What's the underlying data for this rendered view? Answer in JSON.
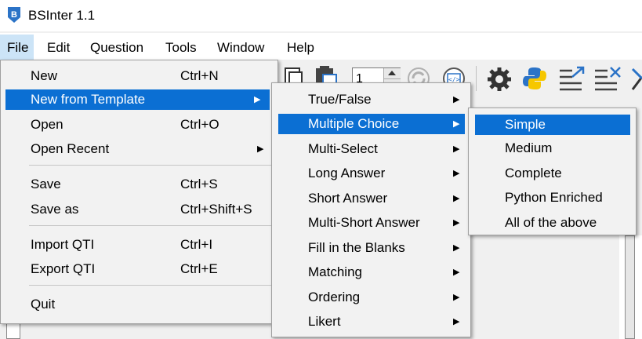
{
  "window": {
    "title": "BSInter 1.1"
  },
  "menubar": {
    "items": [
      "File",
      "Edit",
      "Question",
      "Tools",
      "Window",
      "Help"
    ]
  },
  "toolbar": {
    "spin_value": "1"
  },
  "file_menu": {
    "items": [
      {
        "label": "New",
        "shortcut": "Ctrl+N"
      },
      {
        "label": "New from Template",
        "shortcut": ""
      },
      {
        "label": "Open",
        "shortcut": "Ctrl+O"
      },
      {
        "label": "Open Recent",
        "shortcut": ""
      },
      {
        "label": "Save",
        "shortcut": "Ctrl+S"
      },
      {
        "label": "Save as",
        "shortcut": "Ctrl+Shift+S"
      },
      {
        "label": "Import QTI",
        "shortcut": "Ctrl+I"
      },
      {
        "label": "Export QTI",
        "shortcut": "Ctrl+E"
      },
      {
        "label": "Quit",
        "shortcut": ""
      }
    ]
  },
  "template_menu": {
    "items": [
      "True/False",
      "Multiple Choice",
      "Multi-Select",
      "Long Answer",
      "Short Answer",
      "Multi-Short Answer",
      "Fill in the Blanks",
      "Matching",
      "Ordering",
      "Likert"
    ]
  },
  "mc_menu": {
    "items": [
      "Simple",
      "Medium",
      "Complete",
      "Python Enriched",
      "All of the above"
    ]
  },
  "colors": {
    "highlight": "#0b6fd3",
    "menubar_highlight": "#cce4f7",
    "icon_blue": "#2b73c7"
  }
}
